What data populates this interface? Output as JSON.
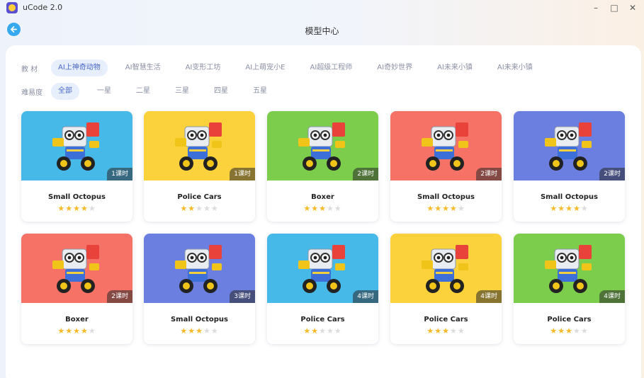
{
  "window": {
    "title": "uCode 2.0"
  },
  "header": {
    "title": "模型中心"
  },
  "filters": {
    "material": {
      "label": "教 材",
      "items": [
        "AI上神奇动物",
        "AI智慧生活",
        "AI变形工坊",
        "AI上萌宠小E",
        "AI超级工程师",
        "AI奇妙世界",
        "AI未来小镇",
        "AI未来小镇"
      ],
      "active_index": 0
    },
    "difficulty": {
      "label": "难易度",
      "items": [
        "全部",
        "一星",
        "二星",
        "三星",
        "四星",
        "五星"
      ],
      "active_index": 0
    }
  },
  "colors": {
    "blue": "#47b9e8",
    "yellow": "#fbd13c",
    "green": "#7ccd4c",
    "red": "#f67267",
    "purple": "#6b7fe0",
    "accent": "#4a67c9"
  },
  "cards": [
    {
      "title": "Small Octopus",
      "lessons": "1课时",
      "stars": 4,
      "bg": "blue"
    },
    {
      "title": "Police Cars",
      "lessons": "1课时",
      "stars": 2,
      "bg": "yellow"
    },
    {
      "title": "Boxer",
      "lessons": "2课时",
      "stars": 3,
      "bg": "green"
    },
    {
      "title": "Small Octopus",
      "lessons": "2课时",
      "stars": 4,
      "bg": "red"
    },
    {
      "title": "Small Octopus",
      "lessons": "2课时",
      "stars": 4,
      "bg": "purple"
    },
    {
      "title": "Boxer",
      "lessons": "2课时",
      "stars": 4,
      "bg": "red"
    },
    {
      "title": "Small Octopus",
      "lessons": "3课时",
      "stars": 3,
      "bg": "purple"
    },
    {
      "title": "Police Cars",
      "lessons": "4课时",
      "stars": 2,
      "bg": "blue"
    },
    {
      "title": "Police Cars",
      "lessons": "4课时",
      "stars": 3,
      "bg": "yellow"
    },
    {
      "title": "Police Cars",
      "lessons": "4课时",
      "stars": 3,
      "bg": "green"
    }
  ]
}
